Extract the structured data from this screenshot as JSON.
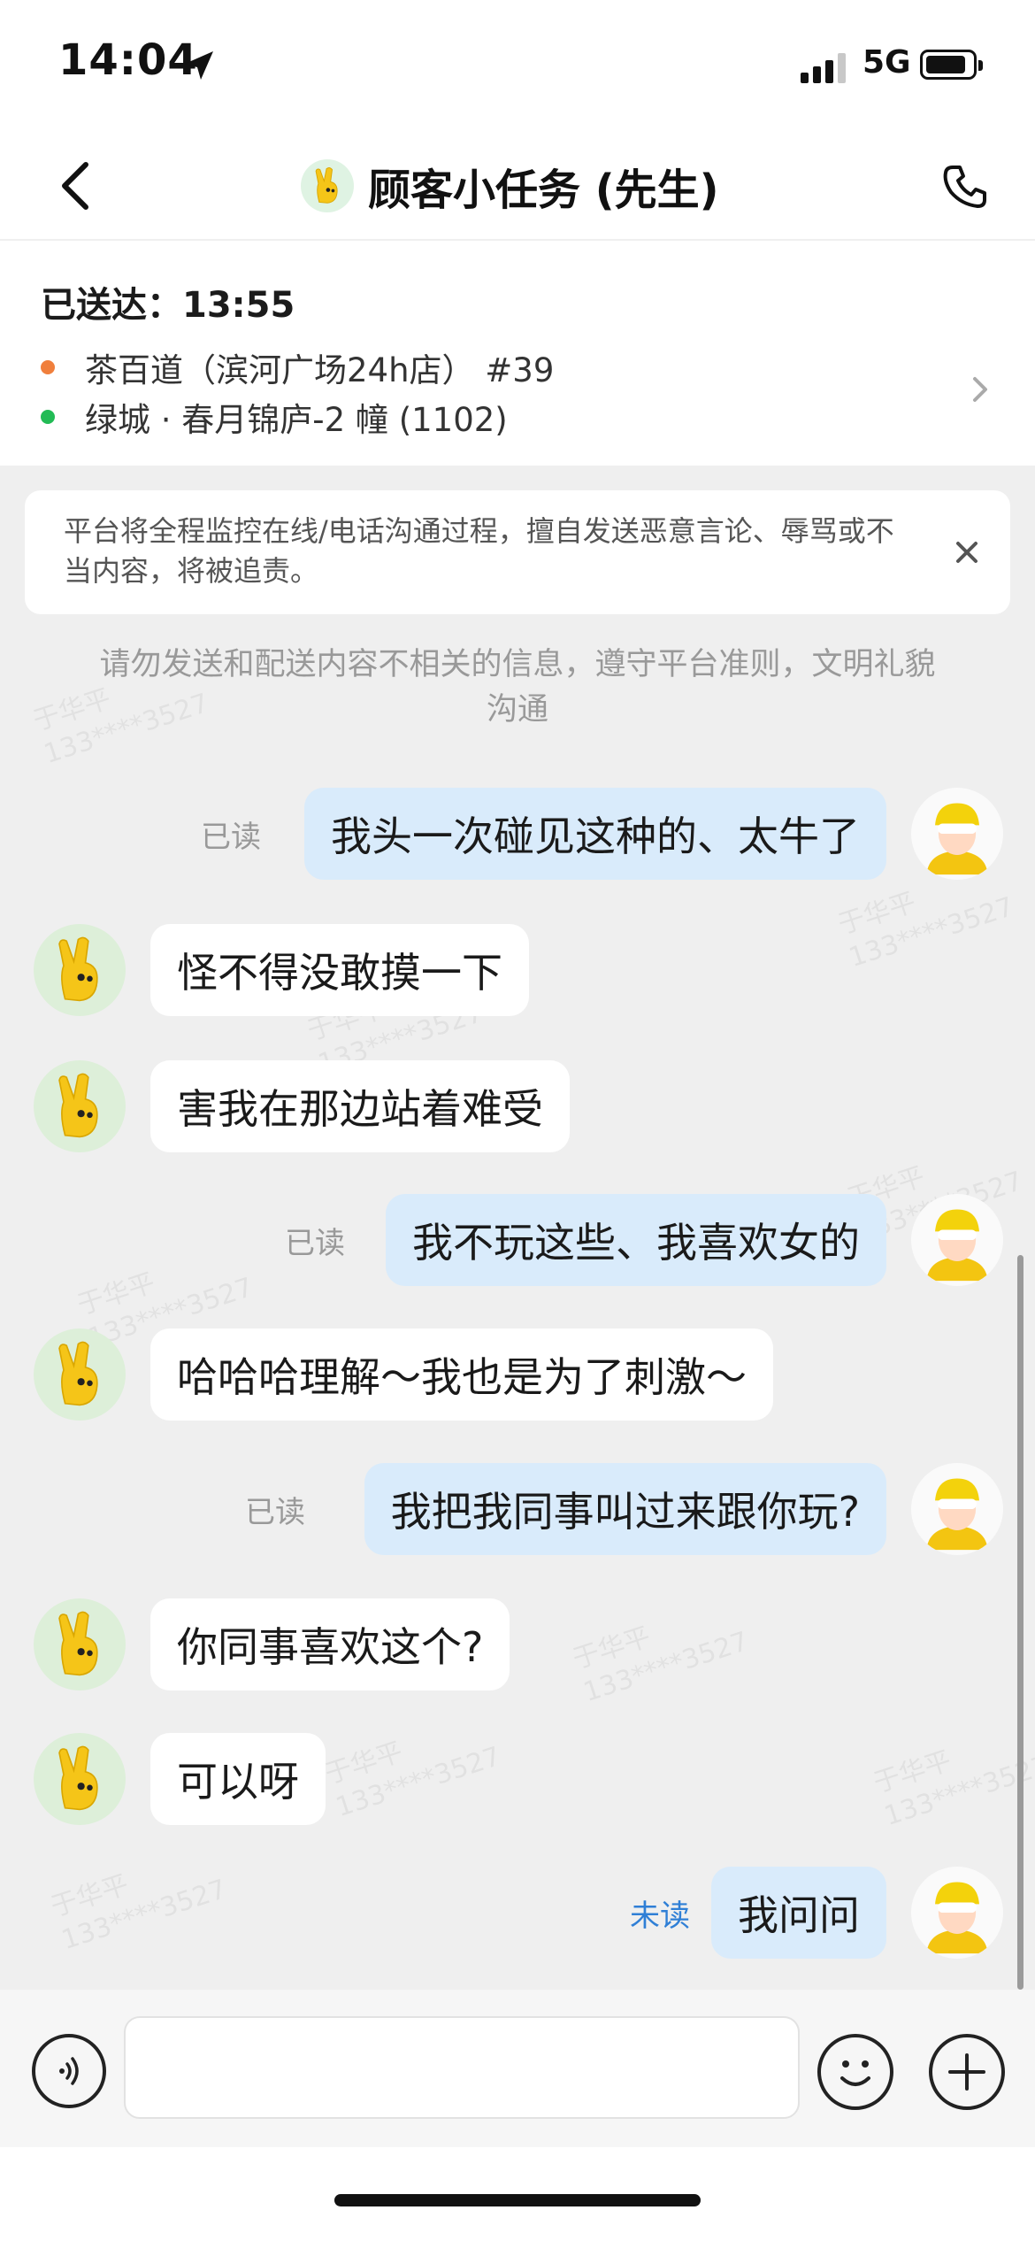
{
  "status_bar": {
    "time": "14:04",
    "network": "5G"
  },
  "nav": {
    "title": "顾客小任务 (先生)"
  },
  "order": {
    "delivered_label": "已送达：13:55",
    "store": "茶百道（滨河广场24h店） #39",
    "address": "绿城 · 春月锦庐-2 幢 (1102)",
    "store_dot_color": "#f07f3c",
    "address_dot_color": "#22bb55"
  },
  "notice": {
    "text": "平台将全程监控在线/电话沟通过程，擅自发送恶意言论、辱骂或不当内容，将被追责。"
  },
  "system_tip": {
    "text": "请勿发送和配送内容不相关的信息，遵守平台准则，文明礼貌沟通"
  },
  "watermark": {
    "name": "于华平",
    "number": "133****3527"
  },
  "messages": [
    {
      "direction": "out",
      "text": "我头一次碰见这种的、太牛了",
      "status": "已读"
    },
    {
      "direction": "in",
      "text": "怪不得没敢摸一下"
    },
    {
      "direction": "in",
      "text": "害我在那边站着难受"
    },
    {
      "direction": "out",
      "text": "我不玩这些、我喜欢女的",
      "status": "已读"
    },
    {
      "direction": "in",
      "text": "哈哈哈理解～我也是为了刺激～"
    },
    {
      "direction": "out",
      "text": "我把我同事叫过来跟你玩?",
      "status": "已读"
    },
    {
      "direction": "in",
      "text": "你同事喜欢这个?"
    },
    {
      "direction": "in",
      "text": "可以呀"
    },
    {
      "direction": "out",
      "text": "我问问",
      "status": "未读"
    }
  ],
  "input": {
    "placeholder": "",
    "value": ""
  },
  "icons": {
    "back": "chevron-left-icon",
    "call": "phone-icon",
    "location": "location-arrow-icon",
    "close": "close-icon",
    "voice": "voice-icon",
    "emoji": "emoji-icon",
    "more": "plus-icon"
  },
  "colors": {
    "chat_background": "#efefef",
    "outgoing_bubble": "#d9ebfb",
    "incoming_bubble": "#ffffff",
    "unread_status": "#2f7fd6",
    "read_status": "#999999"
  }
}
